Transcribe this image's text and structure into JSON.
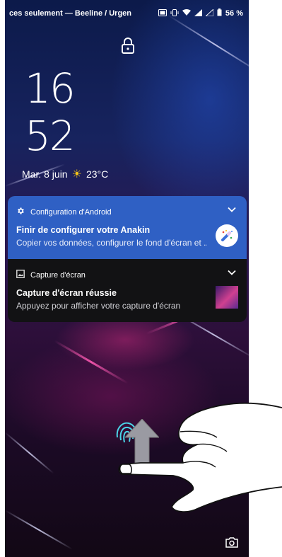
{
  "status_bar": {
    "carrier_text": "ces seulement — Beeline / Urgen",
    "battery": "56 %",
    "icons": [
      "screenshot-icon",
      "vibrate-icon",
      "wifi-icon",
      "signal-icon",
      "signal-icon",
      "battery-icon"
    ]
  },
  "lock_screen": {
    "lock_icon": "lock-icon",
    "clock_hours": "16",
    "clock_minutes": "52",
    "date": "Mar. 8 juin",
    "weather_icon": "sun-icon",
    "temperature": "23°C"
  },
  "notifications": [
    {
      "app_name": "Configuration d'Android",
      "app_icon": "gear-icon",
      "title": "Finir de configurer votre Anakin",
      "text": "Copier vos données, configurer le fond d'écran et ..",
      "background": "#2f60c4",
      "large_icon": "magic-wand-icon"
    },
    {
      "app_name": "Capture d'écran",
      "app_icon": "image-icon",
      "title": "Capture d'écran réussie",
      "text": "Appuyez pour afficher votre capture d'écran",
      "background": "#121214",
      "large_icon": "screenshot-thumbnail"
    }
  ],
  "bottom": {
    "fingerprint_icon": "fingerprint-icon",
    "unlock_arrow_icon": "arrow-up-icon",
    "camera_icon": "camera-icon"
  },
  "overlay": {
    "gesture_hint": "hand-swipe-up-illustration"
  }
}
